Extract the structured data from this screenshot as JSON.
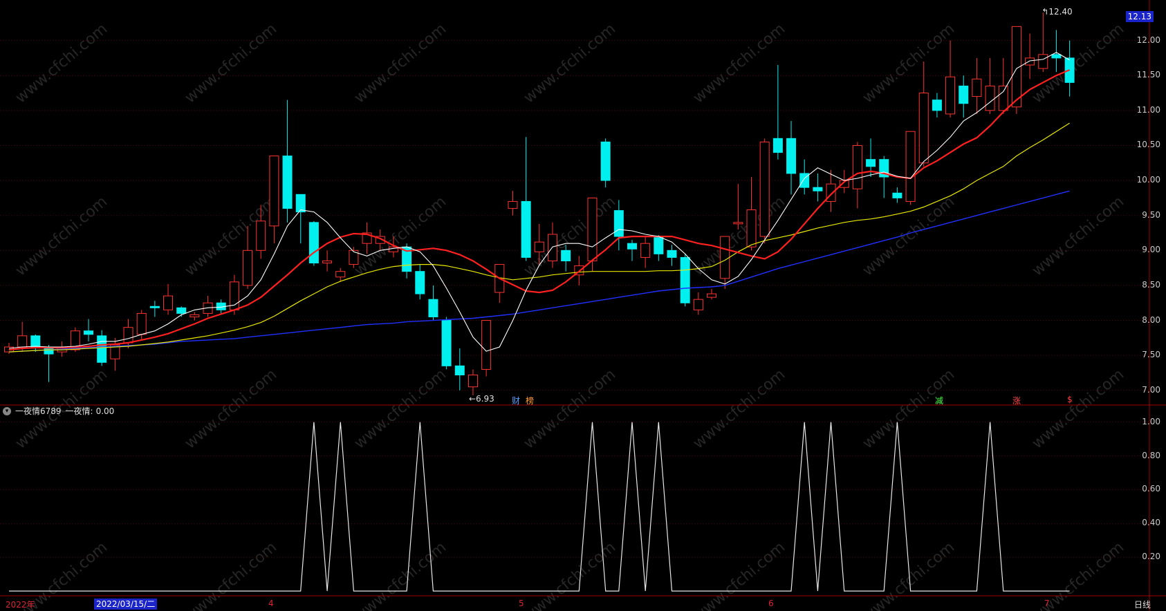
{
  "chart_data": {
    "type": "candlestick",
    "price_axis": {
      "ticks": [
        "12.00",
        "11.50",
        "11.00",
        "10.50",
        "10.00",
        "9.50",
        "9.00",
        "8.50",
        "8.00",
        "7.50",
        "7.00"
      ],
      "tick_values": [
        12.0,
        11.5,
        11.0,
        10.5,
        10.0,
        9.5,
        9.0,
        8.5,
        8.0,
        7.5,
        7.0
      ],
      "ylim": [
        6.83,
        12.48
      ]
    },
    "last_price": "12.13",
    "high_label": "12.40",
    "low_label": "6.93",
    "candles": [
      [
        7.55,
        7.62,
        7.68,
        7.52
      ],
      [
        7.62,
        7.78,
        7.98,
        7.55
      ],
      [
        7.78,
        7.62,
        7.8,
        7.55
      ],
      [
        7.6,
        7.52,
        7.65,
        7.12
      ],
      [
        7.55,
        7.62,
        7.7,
        7.48
      ],
      [
        7.58,
        7.85,
        7.9,
        7.55
      ],
      [
        7.85,
        7.8,
        8.02,
        7.7
      ],
      [
        7.78,
        7.4,
        7.86,
        7.35
      ],
      [
        7.45,
        7.65,
        7.75,
        7.28
      ],
      [
        7.68,
        7.9,
        8.02,
        7.6
      ],
      [
        7.8,
        8.1,
        8.15,
        7.72
      ],
      [
        8.2,
        8.18,
        8.28,
        8.05
      ],
      [
        8.15,
        8.35,
        8.52,
        8.08
      ],
      [
        8.18,
        8.1,
        8.2,
        8.05
      ],
      [
        8.05,
        8.08,
        8.12,
        8.0
      ],
      [
        8.1,
        8.25,
        8.35,
        8.05
      ],
      [
        8.25,
        8.15,
        8.3,
        8.1
      ],
      [
        8.15,
        8.55,
        8.65,
        8.08
      ],
      [
        8.5,
        9.0,
        9.35,
        8.45
      ],
      [
        9.0,
        9.42,
        9.65,
        8.88
      ],
      [
        9.35,
        10.35,
        10.35,
        9.1
      ],
      [
        10.35,
        9.6,
        11.15,
        9.4
      ],
      [
        9.8,
        9.55,
        9.75,
        9.1
      ],
      [
        9.4,
        8.82,
        9.42,
        8.78
      ],
      [
        8.82,
        8.85,
        9.0,
        8.7
      ],
      [
        8.62,
        8.7,
        8.75,
        8.55
      ],
      [
        8.8,
        9.0,
        9.05,
        8.75
      ],
      [
        9.1,
        9.25,
        9.4,
        8.95
      ],
      [
        9.1,
        9.2,
        9.3,
        9.0
      ],
      [
        8.98,
        9.05,
        9.2,
        8.9
      ],
      [
        9.05,
        8.7,
        9.1,
        8.6
      ],
      [
        8.7,
        8.38,
        8.8,
        8.3
      ],
      [
        8.3,
        8.05,
        8.5,
        8.0
      ],
      [
        8.0,
        7.35,
        8.05,
        7.3
      ],
      [
        7.35,
        7.22,
        7.6,
        7.0
      ],
      [
        7.05,
        7.22,
        7.3,
        6.93
      ],
      [
        7.3,
        8.0,
        8.0,
        7.2
      ],
      [
        8.4,
        8.8,
        8.8,
        8.25
      ],
      [
        9.6,
        9.7,
        9.85,
        9.5
      ],
      [
        9.7,
        8.9,
        10.62,
        8.85
      ],
      [
        8.98,
        9.12,
        9.38,
        8.8
      ],
      [
        8.85,
        9.23,
        9.4,
        8.75
      ],
      [
        9.0,
        8.85,
        9.08,
        8.7
      ],
      [
        8.65,
        8.78,
        8.92,
        8.5
      ],
      [
        8.85,
        9.75,
        9.75,
        8.7
      ],
      [
        10.55,
        10.0,
        10.6,
        9.9
      ],
      [
        9.57,
        9.2,
        9.72,
        9.0
      ],
      [
        9.1,
        9.02,
        9.15,
        8.85
      ],
      [
        8.9,
        9.1,
        9.2,
        8.75
      ],
      [
        9.2,
        8.95,
        9.22,
        8.85
      ],
      [
        9.0,
        8.9,
        9.08,
        8.78
      ],
      [
        8.9,
        8.25,
        8.95,
        8.2
      ],
      [
        8.15,
        8.3,
        8.4,
        8.08
      ],
      [
        8.33,
        8.38,
        8.45,
        8.3
      ],
      [
        8.6,
        9.2,
        9.2,
        8.45
      ],
      [
        9.38,
        9.4,
        9.95,
        9.3
      ],
      [
        9.05,
        9.58,
        10.05,
        9.0
      ],
      [
        9.2,
        10.55,
        10.6,
        9.1
      ],
      [
        10.6,
        10.4,
        11.65,
        10.3
      ],
      [
        10.6,
        10.1,
        10.85,
        9.8
      ],
      [
        10.1,
        9.9,
        10.3,
        9.8
      ],
      [
        9.9,
        9.85,
        10.1,
        9.7
      ],
      [
        9.7,
        9.95,
        10.15,
        9.55
      ],
      [
        9.9,
        10.0,
        10.15,
        9.82
      ],
      [
        9.88,
        10.5,
        10.55,
        9.6
      ],
      [
        10.3,
        10.2,
        10.6,
        10.05
      ],
      [
        10.3,
        10.05,
        10.35,
        9.75
      ],
      [
        9.82,
        9.75,
        9.9,
        9.68
      ],
      [
        9.7,
        10.7,
        10.7,
        9.65
      ],
      [
        10.25,
        11.25,
        11.7,
        10.2
      ],
      [
        11.15,
        11.0,
        11.25,
        10.9
      ],
      [
        10.95,
        11.48,
        12.0,
        10.9
      ],
      [
        11.35,
        11.1,
        11.5,
        10.9
      ],
      [
        11.2,
        11.45,
        11.75,
        10.95
      ],
      [
        11.0,
        11.35,
        11.75,
        10.95
      ],
      [
        11.0,
        11.35,
        11.75,
        10.95
      ],
      [
        11.05,
        12.2,
        12.2,
        10.95
      ],
      [
        11.65,
        11.75,
        12.1,
        11.45
      ],
      [
        11.6,
        11.8,
        12.4,
        11.55
      ],
      [
        11.8,
        11.75,
        12.15,
        11.55
      ],
      [
        11.75,
        11.4,
        12.0,
        11.2
      ]
    ],
    "ma5": [
      7.6,
      7.62,
      7.63,
      7.62,
      7.62,
      7.63,
      7.66,
      7.7,
      7.7,
      7.74,
      7.8,
      7.85,
      7.95,
      8.08,
      8.15,
      8.18,
      8.19,
      8.22,
      8.35,
      8.58,
      8.95,
      9.35,
      9.58,
      9.55,
      9.4,
      9.18,
      8.98,
      8.92,
      9.0,
      9.03,
      9.05,
      8.98,
      8.78,
      8.46,
      8.12,
      7.76,
      7.56,
      7.62,
      8.0,
      8.43,
      8.79,
      9.05,
      9.1,
      9.1,
      9.05,
      9.18,
      9.3,
      9.28,
      9.23,
      9.2,
      9.12,
      8.95,
      8.74,
      8.58,
      8.52,
      8.63,
      8.87,
      9.15,
      9.43,
      9.73,
      10.03,
      10.18,
      10.09,
      10.0,
      10.03,
      10.08,
      10.12,
      10.06,
      10.03,
      10.27,
      10.43,
      10.62,
      10.85,
      10.97,
      11.12,
      11.27,
      11.6,
      11.71,
      11.73,
      11.83,
      11.72
    ],
    "ma10": [
      7.58,
      7.6,
      7.61,
      7.61,
      7.61,
      7.62,
      7.63,
      7.65,
      7.66,
      7.68,
      7.72,
      7.76,
      7.81,
      7.88,
      7.95,
      8.03,
      8.09,
      8.15,
      8.22,
      8.33,
      8.49,
      8.65,
      8.82,
      8.97,
      9.1,
      9.19,
      9.24,
      9.23,
      9.17,
      9.07,
      8.99,
      9.01,
      9.03,
      9.0,
      8.94,
      8.85,
      8.73,
      8.6,
      8.51,
      8.42,
      8.4,
      8.43,
      8.55,
      8.7,
      8.86,
      9.01,
      9.18,
      9.2,
      9.2,
      9.2,
      9.2,
      9.15,
      9.1,
      9.07,
      9.02,
      8.97,
      8.92,
      8.88,
      8.98,
      9.16,
      9.38,
      9.6,
      9.8,
      9.98,
      10.1,
      10.13,
      10.1,
      10.05,
      10.03,
      10.18,
      10.28,
      10.4,
      10.52,
      10.61,
      10.78,
      10.98,
      11.15,
      11.3,
      11.4,
      11.5,
      11.58
    ],
    "ma20": [
      7.55,
      7.56,
      7.57,
      7.58,
      7.58,
      7.59,
      7.6,
      7.61,
      7.62,
      7.63,
      7.65,
      7.67,
      7.69,
      7.72,
      7.75,
      7.78,
      7.82,
      7.86,
      7.91,
      7.97,
      8.06,
      8.17,
      8.28,
      8.38,
      8.48,
      8.56,
      8.62,
      8.68,
      8.73,
      8.77,
      8.79,
      8.8,
      8.8,
      8.78,
      8.74,
      8.7,
      8.65,
      8.61,
      8.58,
      8.6,
      8.62,
      8.65,
      8.67,
      8.69,
      8.7,
      8.7,
      8.7,
      8.7,
      8.7,
      8.71,
      8.71,
      8.72,
      8.74,
      8.77,
      8.86,
      8.98,
      9.08,
      9.14,
      9.18,
      9.22,
      9.27,
      9.32,
      9.36,
      9.4,
      9.43,
      9.45,
      9.48,
      9.52,
      9.56,
      9.62,
      9.7,
      9.78,
      9.88,
      10.0,
      10.1,
      10.2,
      10.35,
      10.47,
      10.58,
      10.7,
      10.82
    ],
    "ma60": [
      7.55,
      7.56,
      7.57,
      7.58,
      7.59,
      7.6,
      7.61,
      7.62,
      7.63,
      7.64,
      7.65,
      7.66,
      7.68,
      7.7,
      7.71,
      7.72,
      7.73,
      7.74,
      7.76,
      7.78,
      7.8,
      7.82,
      7.84,
      7.86,
      7.88,
      7.9,
      7.92,
      7.94,
      7.95,
      7.96,
      7.98,
      7.99,
      8.0,
      8.01,
      8.02,
      8.03,
      8.05,
      8.07,
      8.09,
      8.12,
      8.15,
      8.18,
      8.21,
      8.24,
      8.27,
      8.3,
      8.33,
      8.36,
      8.39,
      8.42,
      8.44,
      8.46,
      8.47,
      8.48,
      8.5,
      8.56,
      8.62,
      8.68,
      8.74,
      8.79,
      8.84,
      8.89,
      8.94,
      8.99,
      9.04,
      9.09,
      9.14,
      9.19,
      9.25,
      9.3,
      9.35,
      9.4,
      9.45,
      9.5,
      9.55,
      9.6,
      9.65,
      9.7,
      9.75,
      9.8,
      9.85
    ],
    "indicator": {
      "ticks": [
        "1.00",
        "0.80",
        "0.60",
        "0.40",
        "0.20"
      ],
      "tick_values": [
        1.0,
        0.8,
        0.6,
        0.4,
        0.2
      ],
      "ylim": [
        -0.02,
        1.06
      ],
      "values": [
        0,
        0,
        0,
        0,
        0,
        0,
        0,
        0,
        0,
        0,
        0,
        0,
        0,
        0,
        0,
        0,
        0,
        0,
        0,
        0,
        0,
        0,
        0,
        1,
        0,
        1,
        0,
        0,
        0,
        0,
        0,
        1,
        0,
        0,
        0,
        0,
        0,
        0,
        0,
        0,
        0,
        0,
        0,
        0,
        1,
        0,
        0,
        1,
        0,
        1,
        0,
        0,
        0,
        0,
        0,
        0,
        0,
        0,
        0,
        0,
        1,
        0,
        1,
        0,
        0,
        0,
        0,
        1,
        0,
        0,
        0,
        0,
        0,
        0,
        1,
        0,
        0,
        0,
        0,
        0,
        0
      ]
    }
  },
  "colors": {
    "up": "#ff3232",
    "down": "#00f0f0",
    "ma5": "#ffffff",
    "ma10": "#ff2020",
    "ma20": "#e8e800",
    "ma60": "#2030ff",
    "grid": "#5a0000",
    "border": "#a00000"
  },
  "events": [
    {
      "label": "财",
      "color": "#5aa0ff"
    },
    {
      "label": "榜",
      "color": "#ff9a30"
    },
    {
      "label": "减",
      "color": "#40ff40"
    },
    {
      "label": "涨",
      "color": "#ff4040"
    },
    {
      "label": "$",
      "color": "#ff4040"
    }
  ],
  "indicator_header": {
    "name": "一夜情6789",
    "series_label": "一夜情:",
    "value": "0.00"
  },
  "x_axis": {
    "year_label": "2022年",
    "cursor_date": "2022/03/15/二",
    "months": [
      "4",
      "5",
      "6",
      "7"
    ]
  },
  "period_label": "日线"
}
